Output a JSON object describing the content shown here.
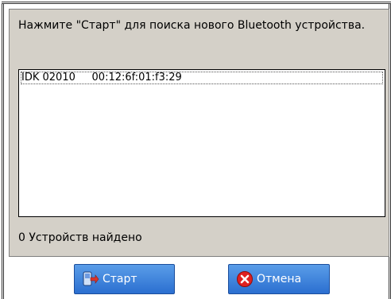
{
  "dialog": {
    "instruction": "Нажмите \"Старт\" для поиска нового Bluetooth устройства.",
    "devices": [
      {
        "name": "IDK 02010",
        "address": "00:12:6f:01:f3:29"
      }
    ],
    "status": "0 Устройств найдено"
  },
  "buttons": {
    "start_label": "Старт",
    "cancel_label": "Отмена"
  },
  "colors": {
    "panel": "#d4d0c8",
    "button": "#3d82dc",
    "cancel_icon": "#e02020"
  },
  "icons": {
    "start": "device-arrow-icon",
    "cancel": "red-x-icon"
  }
}
